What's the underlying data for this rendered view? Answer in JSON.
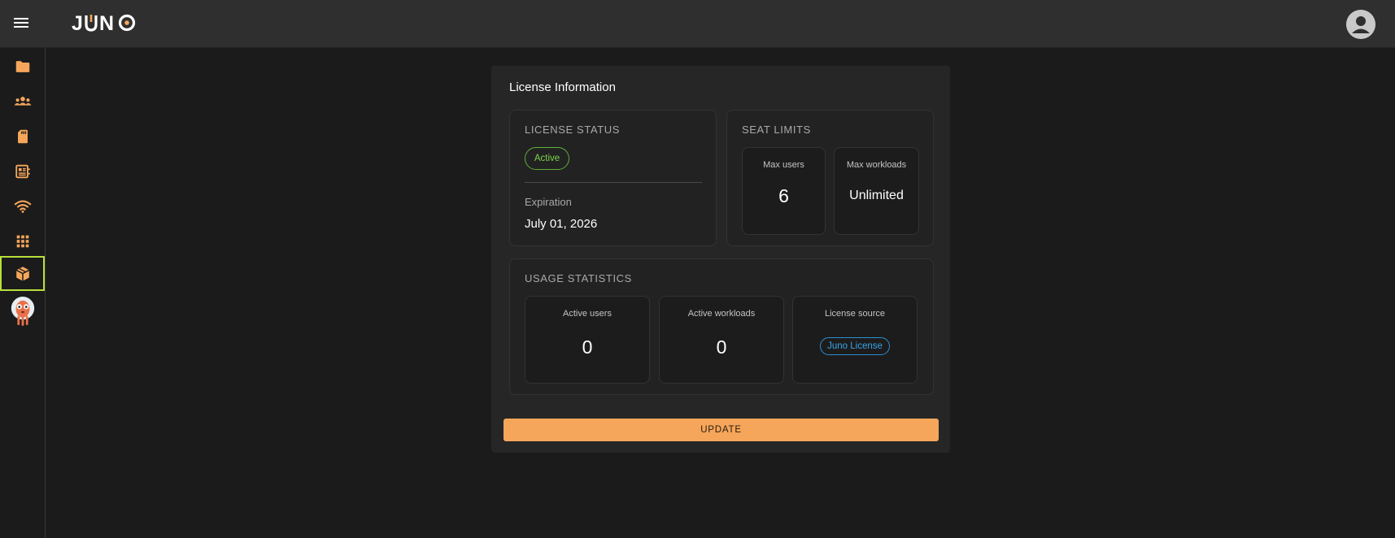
{
  "app": {
    "logo_text": "JUNO",
    "colors": {
      "accent": "#f5a65b",
      "active_outline": "#b7e03a",
      "status_green": "#7fd34a",
      "info_blue": "#38a4e8"
    }
  },
  "topbar": {
    "menu_icon": "menu-icon",
    "user_icon": "account-circle-icon"
  },
  "sidebar": {
    "items": [
      {
        "icon": "folder-icon",
        "active": false
      },
      {
        "icon": "groups-icon",
        "active": false
      },
      {
        "icon": "sd-card-icon",
        "active": false
      },
      {
        "icon": "memory-icon",
        "active": false
      },
      {
        "icon": "wifi-icon",
        "active": false
      },
      {
        "icon": "apps-grid-icon",
        "active": false
      },
      {
        "icon": "package-icon",
        "active": true
      },
      {
        "icon": "argo-mascot-icon",
        "active": false
      }
    ]
  },
  "license": {
    "title": "License Information",
    "status": {
      "heading": "LICENSE STATUS",
      "badge": "Active",
      "expiration_label": "Expiration",
      "expiration_value": "July 01, 2026"
    },
    "seats": {
      "heading": "SEAT LIMITS",
      "max_users_label": "Max users",
      "max_users_value": "6",
      "max_workloads_label": "Max workloads",
      "max_workloads_value": "Unlimited"
    },
    "usage": {
      "heading": "USAGE STATISTICS",
      "active_users_label": "Active users",
      "active_users_value": "0",
      "active_workloads_label": "Active workloads",
      "active_workloads_value": "0",
      "source_label": "License source",
      "source_value": "Juno License"
    },
    "update_label": "UPDATE"
  }
}
